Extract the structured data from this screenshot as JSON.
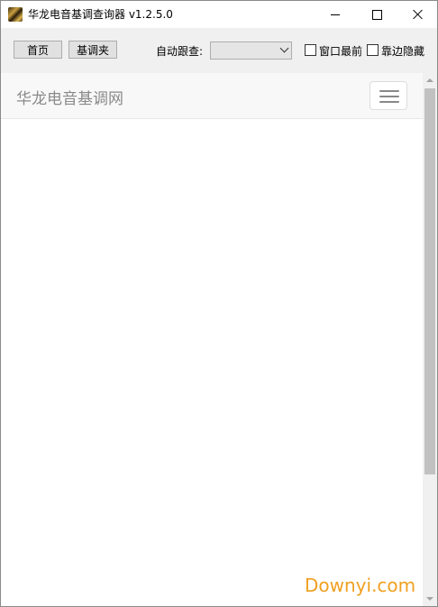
{
  "window": {
    "title": "华龙电音基调查询器 v1.2.5.0",
    "icon": "app-logo-icon"
  },
  "toolbar": {
    "home_label": "首页",
    "folder_label": "基调夹",
    "follow_label": "自动跟查:",
    "follow_value": "",
    "always_on_top_label": "窗口最前",
    "always_on_top_checked": false,
    "dock_hide_label": "靠边隐藏",
    "dock_hide_checked": false
  },
  "web": {
    "brand": "华龙电音基调网",
    "menu_icon": "hamburger-icon"
  },
  "watermark": "Downyi.com",
  "colors": {
    "toolbar_bg": "#f0f0f0",
    "navbar_bg": "#f8f8f8",
    "brand_text": "#8a8a8a",
    "watermark": "#f0a020"
  }
}
